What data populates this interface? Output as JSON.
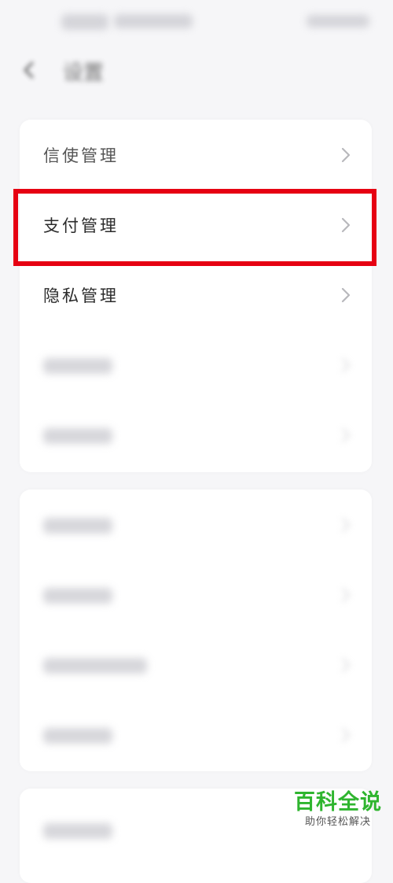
{
  "header": {
    "title": "设置"
  },
  "card1": {
    "items": [
      {
        "label": "信使管理",
        "icon": "chevron-right-icon"
      },
      {
        "label": "支付管理",
        "icon": "chevron-right-icon"
      },
      {
        "label": "隐私管理",
        "icon": "chevron-right-icon"
      },
      {
        "label": "",
        "icon": "chevron-right-icon"
      },
      {
        "label": "",
        "icon": "chevron-right-icon"
      }
    ]
  },
  "card2": {
    "items": [
      {
        "label": "",
        "icon": "chevron-right-icon"
      },
      {
        "label": "",
        "icon": "chevron-right-icon"
      },
      {
        "label": "",
        "icon": "chevron-right-icon"
      },
      {
        "label": "",
        "icon": "chevron-right-icon"
      }
    ]
  },
  "card3": {
    "items": [
      {
        "label": "",
        "icon": "chevron-right-icon"
      }
    ]
  },
  "highlight": {
    "color": "#e60012",
    "target": "支付管理"
  },
  "watermark": {
    "title": "百科全说",
    "subtitle": "助你轻松解决",
    "color": "#2fb52f"
  }
}
